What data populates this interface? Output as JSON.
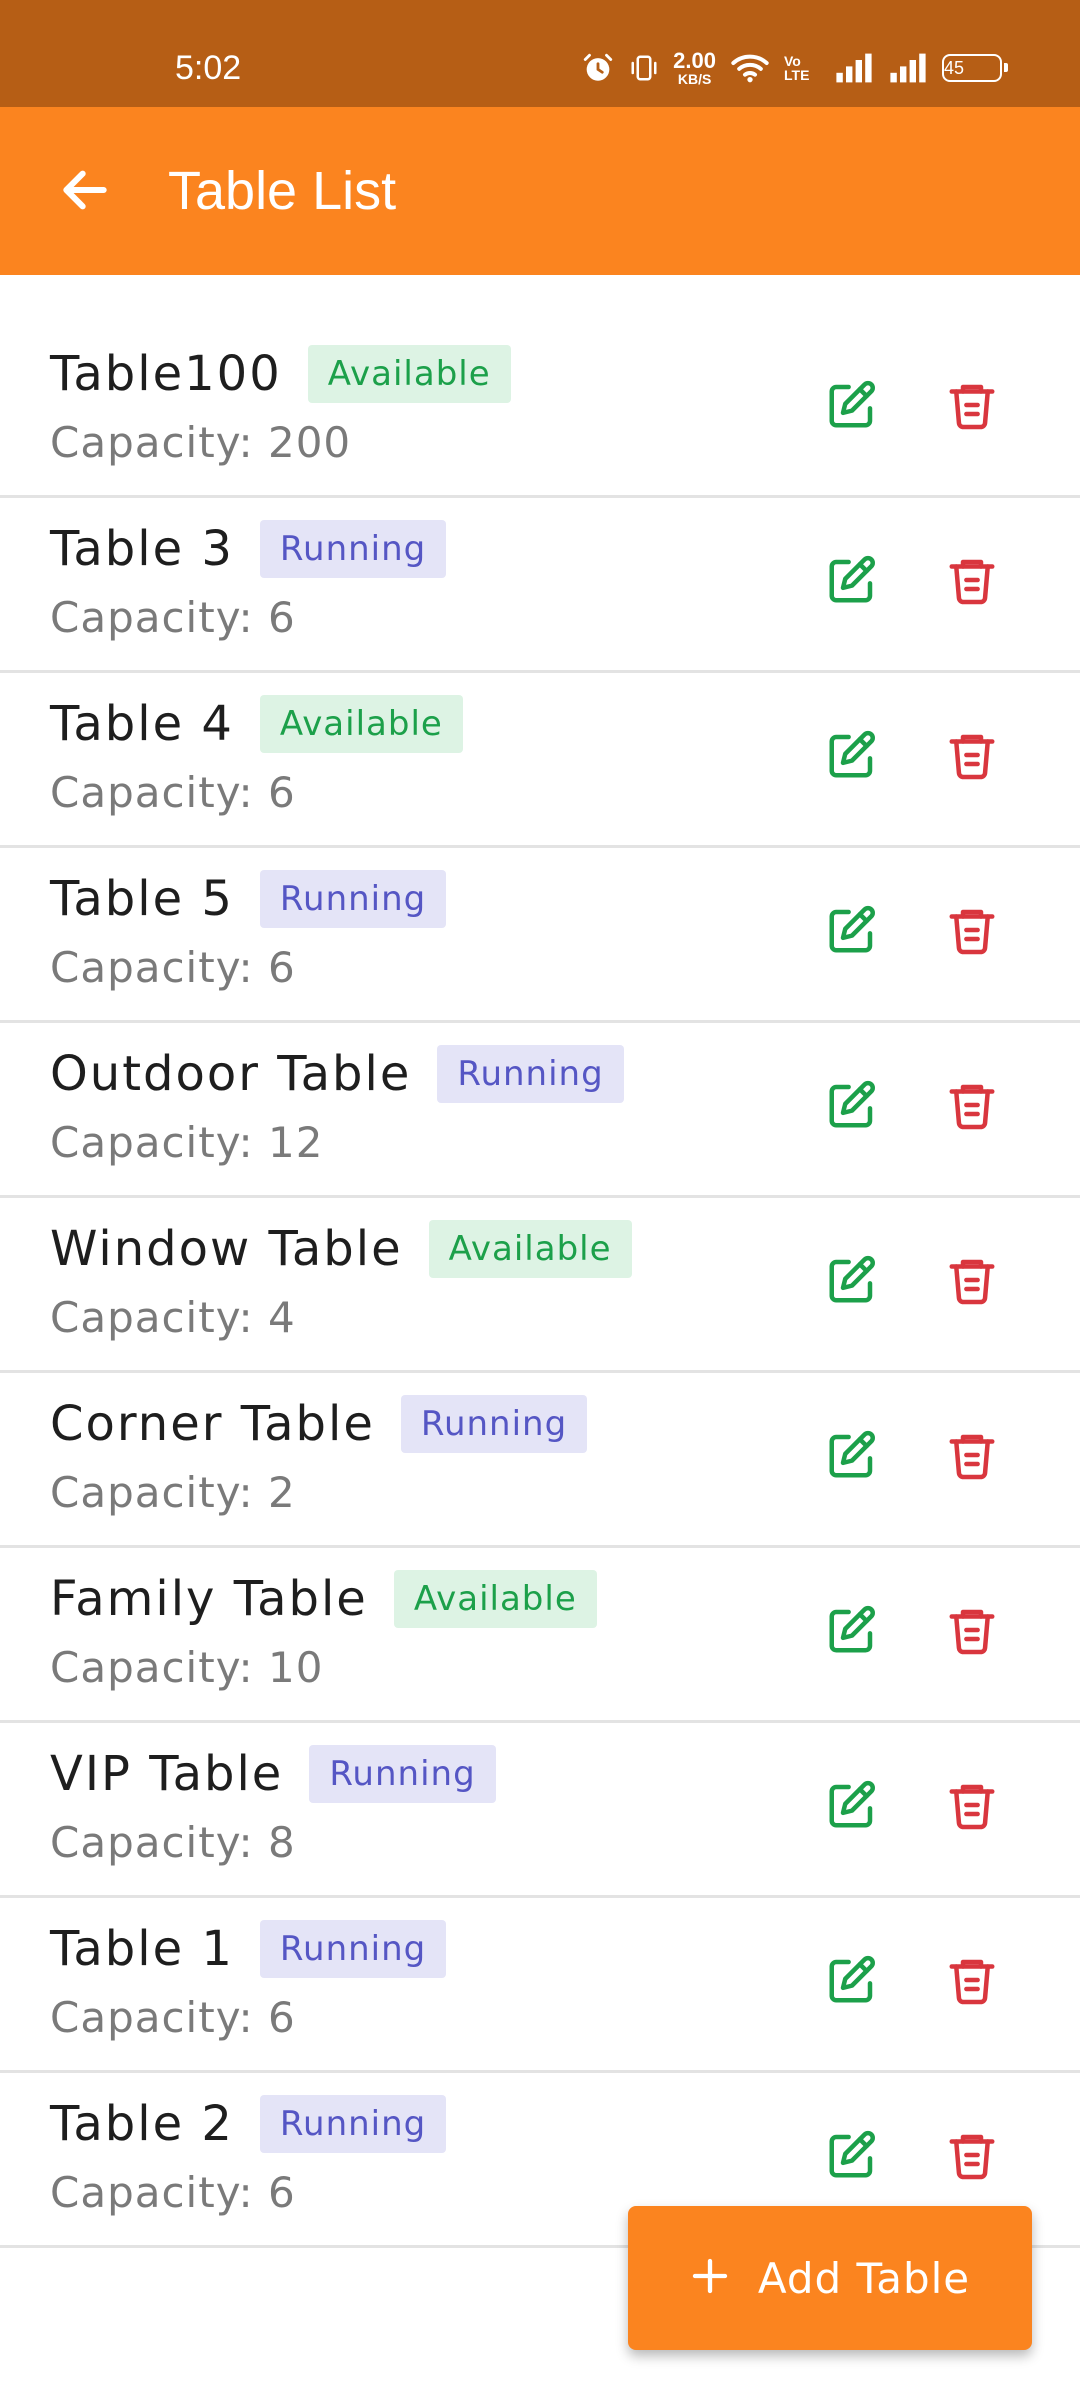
{
  "status_bar": {
    "time": "5:02",
    "net_speed_value": "2.00",
    "net_speed_unit": "KB/S",
    "volte": "Vo LTE",
    "battery": "45"
  },
  "app_bar": {
    "title": "Table List",
    "back_icon": "arrow-left-icon"
  },
  "tables": [
    {
      "name": "Table100",
      "status": "Available",
      "capacity": "Capacity: 200"
    },
    {
      "name": "Table 3",
      "status": "Running",
      "capacity": "Capacity: 6"
    },
    {
      "name": "Table 4",
      "status": "Available",
      "capacity": "Capacity: 6"
    },
    {
      "name": "Table 5",
      "status": "Running",
      "capacity": "Capacity: 6"
    },
    {
      "name": "Outdoor Table",
      "status": "Running",
      "capacity": "Capacity: 12"
    },
    {
      "name": "Window Table",
      "status": "Available",
      "capacity": "Capacity: 4"
    },
    {
      "name": "Corner Table",
      "status": "Running",
      "capacity": "Capacity: 2"
    },
    {
      "name": "Family Table",
      "status": "Available",
      "capacity": "Capacity: 10"
    },
    {
      "name": "VIP Table",
      "status": "Running",
      "capacity": "Capacity: 8"
    },
    {
      "name": "Table 1",
      "status": "Running",
      "capacity": "Capacity: 6"
    },
    {
      "name": "Table 2",
      "status": "Running",
      "capacity": "Capacity: 6"
    }
  ],
  "fab": {
    "label": "Add Table",
    "icon": "plus-icon"
  },
  "colors": {
    "status_bar": "#B65E15",
    "primary": "#FB841F",
    "available_text": "#1CA04A",
    "available_bg": "#DDF3E4",
    "running_text": "#5556C4",
    "running_bg": "#E4E4F7",
    "edit_icon": "#1CA04A",
    "delete_icon": "#D9363E"
  }
}
